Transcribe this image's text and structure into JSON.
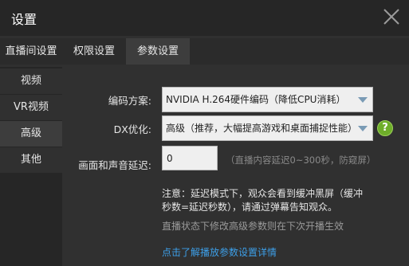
{
  "window": {
    "title": "设置"
  },
  "tabs": [
    {
      "label": "直播间设置"
    },
    {
      "label": "权限设置"
    },
    {
      "label": "参数设置"
    }
  ],
  "sidebar": {
    "items": [
      {
        "label": "视频"
      },
      {
        "label": "VR视频"
      },
      {
        "label": "高级"
      },
      {
        "label": "其他"
      }
    ],
    "active_index": 2
  },
  "form": {
    "encoding": {
      "label": "编码方案:",
      "value": "NVIDIA H.264硬件编码（降低CPU消耗）"
    },
    "dx": {
      "label": "DX优化:",
      "value": "高级（推荐，大幅提高游戏和桌面捕捉性能）",
      "help_symbol": "?"
    },
    "delay": {
      "label": "画面和声音延迟:",
      "value": "0",
      "hint": "（直播内容延迟0~300秒，防窥屏）"
    }
  },
  "note": "注意：延迟模式下，观众会看到缓冲黑屏（缓冲秒数=延迟秒数），请通过弹幕告知观众。",
  "status": "直播状态下修改高级参数则在下次开播生效",
  "link": "点击了解播放参数设置详情",
  "colors": {
    "link": "#3d9fe8",
    "help": "#6eae2a",
    "dropdown_arrow": "#7a9bb5"
  }
}
